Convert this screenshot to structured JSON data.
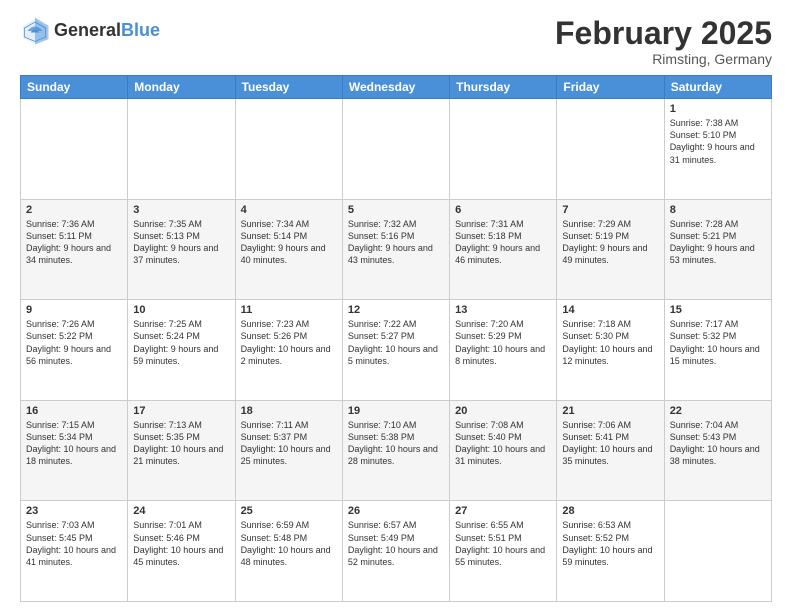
{
  "header": {
    "logo_general": "General",
    "logo_blue": "Blue",
    "month_title": "February 2025",
    "location": "Rimsting, Germany"
  },
  "days_of_week": [
    "Sunday",
    "Monday",
    "Tuesday",
    "Wednesday",
    "Thursday",
    "Friday",
    "Saturday"
  ],
  "weeks": [
    [
      {
        "day": "",
        "info": ""
      },
      {
        "day": "",
        "info": ""
      },
      {
        "day": "",
        "info": ""
      },
      {
        "day": "",
        "info": ""
      },
      {
        "day": "",
        "info": ""
      },
      {
        "day": "",
        "info": ""
      },
      {
        "day": "1",
        "info": "Sunrise: 7:38 AM\nSunset: 5:10 PM\nDaylight: 9 hours and 31 minutes."
      }
    ],
    [
      {
        "day": "2",
        "info": "Sunrise: 7:36 AM\nSunset: 5:11 PM\nDaylight: 9 hours and 34 minutes."
      },
      {
        "day": "3",
        "info": "Sunrise: 7:35 AM\nSunset: 5:13 PM\nDaylight: 9 hours and 37 minutes."
      },
      {
        "day": "4",
        "info": "Sunrise: 7:34 AM\nSunset: 5:14 PM\nDaylight: 9 hours and 40 minutes."
      },
      {
        "day": "5",
        "info": "Sunrise: 7:32 AM\nSunset: 5:16 PM\nDaylight: 9 hours and 43 minutes."
      },
      {
        "day": "6",
        "info": "Sunrise: 7:31 AM\nSunset: 5:18 PM\nDaylight: 9 hours and 46 minutes."
      },
      {
        "day": "7",
        "info": "Sunrise: 7:29 AM\nSunset: 5:19 PM\nDaylight: 9 hours and 49 minutes."
      },
      {
        "day": "8",
        "info": "Sunrise: 7:28 AM\nSunset: 5:21 PM\nDaylight: 9 hours and 53 minutes."
      }
    ],
    [
      {
        "day": "9",
        "info": "Sunrise: 7:26 AM\nSunset: 5:22 PM\nDaylight: 9 hours and 56 minutes."
      },
      {
        "day": "10",
        "info": "Sunrise: 7:25 AM\nSunset: 5:24 PM\nDaylight: 9 hours and 59 minutes."
      },
      {
        "day": "11",
        "info": "Sunrise: 7:23 AM\nSunset: 5:26 PM\nDaylight: 10 hours and 2 minutes."
      },
      {
        "day": "12",
        "info": "Sunrise: 7:22 AM\nSunset: 5:27 PM\nDaylight: 10 hours and 5 minutes."
      },
      {
        "day": "13",
        "info": "Sunrise: 7:20 AM\nSunset: 5:29 PM\nDaylight: 10 hours and 8 minutes."
      },
      {
        "day": "14",
        "info": "Sunrise: 7:18 AM\nSunset: 5:30 PM\nDaylight: 10 hours and 12 minutes."
      },
      {
        "day": "15",
        "info": "Sunrise: 7:17 AM\nSunset: 5:32 PM\nDaylight: 10 hours and 15 minutes."
      }
    ],
    [
      {
        "day": "16",
        "info": "Sunrise: 7:15 AM\nSunset: 5:34 PM\nDaylight: 10 hours and 18 minutes."
      },
      {
        "day": "17",
        "info": "Sunrise: 7:13 AM\nSunset: 5:35 PM\nDaylight: 10 hours and 21 minutes."
      },
      {
        "day": "18",
        "info": "Sunrise: 7:11 AM\nSunset: 5:37 PM\nDaylight: 10 hours and 25 minutes."
      },
      {
        "day": "19",
        "info": "Sunrise: 7:10 AM\nSunset: 5:38 PM\nDaylight: 10 hours and 28 minutes."
      },
      {
        "day": "20",
        "info": "Sunrise: 7:08 AM\nSunset: 5:40 PM\nDaylight: 10 hours and 31 minutes."
      },
      {
        "day": "21",
        "info": "Sunrise: 7:06 AM\nSunset: 5:41 PM\nDaylight: 10 hours and 35 minutes."
      },
      {
        "day": "22",
        "info": "Sunrise: 7:04 AM\nSunset: 5:43 PM\nDaylight: 10 hours and 38 minutes."
      }
    ],
    [
      {
        "day": "23",
        "info": "Sunrise: 7:03 AM\nSunset: 5:45 PM\nDaylight: 10 hours and 41 minutes."
      },
      {
        "day": "24",
        "info": "Sunrise: 7:01 AM\nSunset: 5:46 PM\nDaylight: 10 hours and 45 minutes."
      },
      {
        "day": "25",
        "info": "Sunrise: 6:59 AM\nSunset: 5:48 PM\nDaylight: 10 hours and 48 minutes."
      },
      {
        "day": "26",
        "info": "Sunrise: 6:57 AM\nSunset: 5:49 PM\nDaylight: 10 hours and 52 minutes."
      },
      {
        "day": "27",
        "info": "Sunrise: 6:55 AM\nSunset: 5:51 PM\nDaylight: 10 hours and 55 minutes."
      },
      {
        "day": "28",
        "info": "Sunrise: 6:53 AM\nSunset: 5:52 PM\nDaylight: 10 hours and 59 minutes."
      },
      {
        "day": "",
        "info": ""
      }
    ]
  ]
}
